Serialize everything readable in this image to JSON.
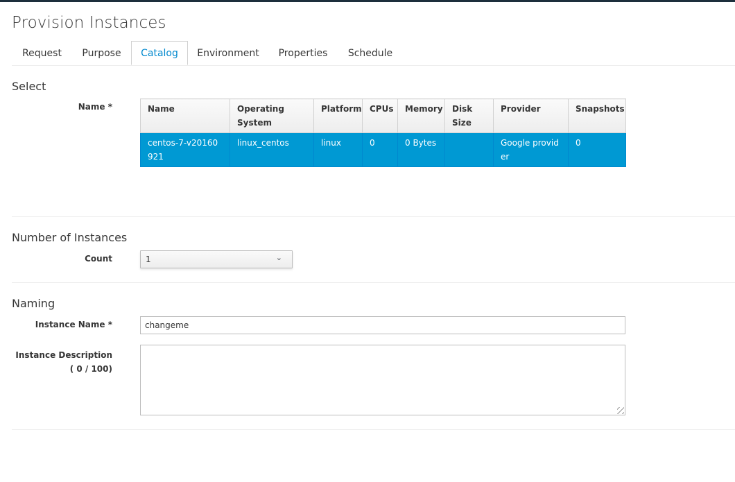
{
  "page": {
    "title": "Provision Instances"
  },
  "tabs": [
    {
      "label": "Request"
    },
    {
      "label": "Purpose"
    },
    {
      "label": "Catalog",
      "active": true
    },
    {
      "label": "Environment"
    },
    {
      "label": "Properties"
    },
    {
      "label": "Schedule"
    }
  ],
  "select_section": {
    "heading": "Select",
    "name_label": "Name *",
    "columns": [
      "Name",
      "Operating System",
      "Platform",
      "CPUs",
      "Memory",
      "Disk Size",
      "Provider",
      "Snapshots"
    ],
    "rows": [
      {
        "cells": [
          "centos-7-v20160921",
          "linux_centos",
          "linux",
          "0",
          "0 Bytes",
          "",
          "Google provider",
          "0"
        ],
        "selected": true
      }
    ]
  },
  "instances_section": {
    "heading": "Number of Instances",
    "count_label": "Count",
    "count_value": "1"
  },
  "naming_section": {
    "heading": "Naming",
    "instance_name_label": "Instance Name *",
    "instance_name_value": "changeme",
    "description_label": "Instance Description ( 0 / 100)",
    "description_value": ""
  },
  "colors": {
    "accent": "#0088ce",
    "selected_row": "#0099d3",
    "topbar": "#1d2f3c"
  }
}
